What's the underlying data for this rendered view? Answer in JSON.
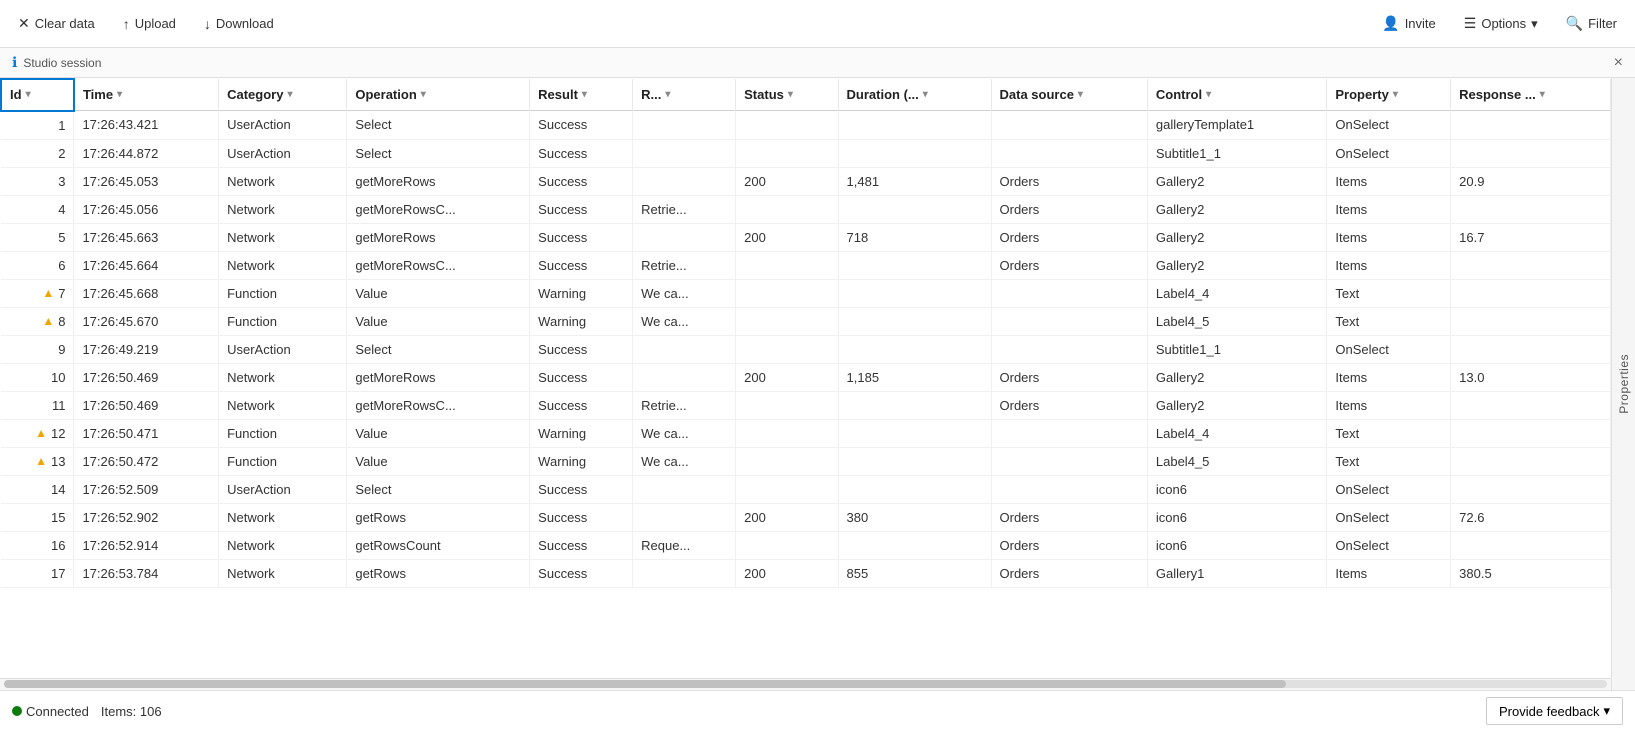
{
  "toolbar": {
    "clear_data_label": "Clear data",
    "upload_label": "Upload",
    "download_label": "Download",
    "invite_label": "Invite",
    "options_label": "Options",
    "filter_label": "Filter"
  },
  "session_bar": {
    "label": "Studio session",
    "close_icon": "×"
  },
  "side_panel": {
    "label": "Properties"
  },
  "columns": [
    {
      "id": "col-id",
      "label": "Id",
      "sortable": true,
      "has_filter": true
    },
    {
      "id": "col-time",
      "label": "Time",
      "sortable": true,
      "has_filter": true
    },
    {
      "id": "col-category",
      "label": "Category",
      "sortable": true,
      "has_filter": true
    },
    {
      "id": "col-operation",
      "label": "Operation",
      "sortable": true,
      "has_filter": true
    },
    {
      "id": "col-result",
      "label": "Result",
      "sortable": true,
      "has_filter": true
    },
    {
      "id": "col-r",
      "label": "R...",
      "sortable": true,
      "has_filter": true
    },
    {
      "id": "col-status",
      "label": "Status",
      "sortable": true,
      "has_filter": true
    },
    {
      "id": "col-duration",
      "label": "Duration (...",
      "sortable": true,
      "has_filter": true
    },
    {
      "id": "col-datasource",
      "label": "Data source",
      "sortable": true,
      "has_filter": true
    },
    {
      "id": "col-control",
      "label": "Control",
      "sortable": true,
      "has_filter": true
    },
    {
      "id": "col-property",
      "label": "Property",
      "sortable": true,
      "has_filter": true
    },
    {
      "id": "col-response",
      "label": "Response ...",
      "sortable": true,
      "has_filter": true
    }
  ],
  "rows": [
    {
      "id": 1,
      "warning": false,
      "time": "17:26:43.421",
      "category": "UserAction",
      "operation": "Select",
      "result": "Success",
      "r": "",
      "status": "",
      "duration": "",
      "datasource": "",
      "control": "galleryTemplate1",
      "property": "OnSelect",
      "response": ""
    },
    {
      "id": 2,
      "warning": false,
      "time": "17:26:44.872",
      "category": "UserAction",
      "operation": "Select",
      "result": "Success",
      "r": "",
      "status": "",
      "duration": "",
      "datasource": "",
      "control": "Subtitle1_1",
      "property": "OnSelect",
      "response": ""
    },
    {
      "id": 3,
      "warning": false,
      "time": "17:26:45.053",
      "category": "Network",
      "operation": "getMoreRows",
      "result": "Success",
      "r": "",
      "status": "200",
      "duration": "1,481",
      "datasource": "Orders",
      "control": "Gallery2",
      "property": "Items",
      "response": "20.9"
    },
    {
      "id": 4,
      "warning": false,
      "time": "17:26:45.056",
      "category": "Network",
      "operation": "getMoreRowsC...",
      "result": "Success",
      "r": "Retrie...",
      "status": "",
      "duration": "",
      "datasource": "Orders",
      "control": "Gallery2",
      "property": "Items",
      "response": ""
    },
    {
      "id": 5,
      "warning": false,
      "time": "17:26:45.663",
      "category": "Network",
      "operation": "getMoreRows",
      "result": "Success",
      "r": "",
      "status": "200",
      "duration": "718",
      "datasource": "Orders",
      "control": "Gallery2",
      "property": "Items",
      "response": "16.7"
    },
    {
      "id": 6,
      "warning": false,
      "time": "17:26:45.664",
      "category": "Network",
      "operation": "getMoreRowsC...",
      "result": "Success",
      "r": "Retrie...",
      "status": "",
      "duration": "",
      "datasource": "Orders",
      "control": "Gallery2",
      "property": "Items",
      "response": ""
    },
    {
      "id": 7,
      "warning": true,
      "time": "17:26:45.668",
      "category": "Function",
      "operation": "Value",
      "result": "Warning",
      "r": "We ca...",
      "status": "",
      "duration": "",
      "datasource": "",
      "control": "Label4_4",
      "property": "Text",
      "response": ""
    },
    {
      "id": 8,
      "warning": true,
      "time": "17:26:45.670",
      "category": "Function",
      "operation": "Value",
      "result": "Warning",
      "r": "We ca...",
      "status": "",
      "duration": "",
      "datasource": "",
      "control": "Label4_5",
      "property": "Text",
      "response": ""
    },
    {
      "id": 9,
      "warning": false,
      "time": "17:26:49.219",
      "category": "UserAction",
      "operation": "Select",
      "result": "Success",
      "r": "",
      "status": "",
      "duration": "",
      "datasource": "",
      "control": "Subtitle1_1",
      "property": "OnSelect",
      "response": ""
    },
    {
      "id": 10,
      "warning": false,
      "time": "17:26:50.469",
      "category": "Network",
      "operation": "getMoreRows",
      "result": "Success",
      "r": "",
      "status": "200",
      "duration": "1,185",
      "datasource": "Orders",
      "control": "Gallery2",
      "property": "Items",
      "response": "13.0"
    },
    {
      "id": 11,
      "warning": false,
      "time": "17:26:50.469",
      "category": "Network",
      "operation": "getMoreRowsC...",
      "result": "Success",
      "r": "Retrie...",
      "status": "",
      "duration": "",
      "datasource": "Orders",
      "control": "Gallery2",
      "property": "Items",
      "response": ""
    },
    {
      "id": 12,
      "warning": true,
      "time": "17:26:50.471",
      "category": "Function",
      "operation": "Value",
      "result": "Warning",
      "r": "We ca...",
      "status": "",
      "duration": "",
      "datasource": "",
      "control": "Label4_4",
      "property": "Text",
      "response": ""
    },
    {
      "id": 13,
      "warning": true,
      "time": "17:26:50.472",
      "category": "Function",
      "operation": "Value",
      "result": "Warning",
      "r": "We ca...",
      "status": "",
      "duration": "",
      "datasource": "",
      "control": "Label4_5",
      "property": "Text",
      "response": ""
    },
    {
      "id": 14,
      "warning": false,
      "time": "17:26:52.509",
      "category": "UserAction",
      "operation": "Select",
      "result": "Success",
      "r": "",
      "status": "",
      "duration": "",
      "datasource": "",
      "control": "icon6",
      "property": "OnSelect",
      "response": ""
    },
    {
      "id": 15,
      "warning": false,
      "time": "17:26:52.902",
      "category": "Network",
      "operation": "getRows",
      "result": "Success",
      "r": "",
      "status": "200",
      "duration": "380",
      "datasource": "Orders",
      "control": "icon6",
      "property": "OnSelect",
      "response": "72.6"
    },
    {
      "id": 16,
      "warning": false,
      "time": "17:26:52.914",
      "category": "Network",
      "operation": "getRowsCount",
      "result": "Success",
      "r": "Reque...",
      "status": "",
      "duration": "",
      "datasource": "Orders",
      "control": "icon6",
      "property": "OnSelect",
      "response": ""
    },
    {
      "id": 17,
      "warning": false,
      "time": "17:26:53.784",
      "category": "Network",
      "operation": "getRows",
      "result": "Success",
      "r": "",
      "status": "200",
      "duration": "855",
      "datasource": "Orders",
      "control": "Gallery1",
      "property": "Items",
      "response": "380.5"
    }
  ],
  "status_bar": {
    "connected_label": "Connected",
    "items_label": "Items: 106",
    "feedback_label": "Provide feedback"
  }
}
